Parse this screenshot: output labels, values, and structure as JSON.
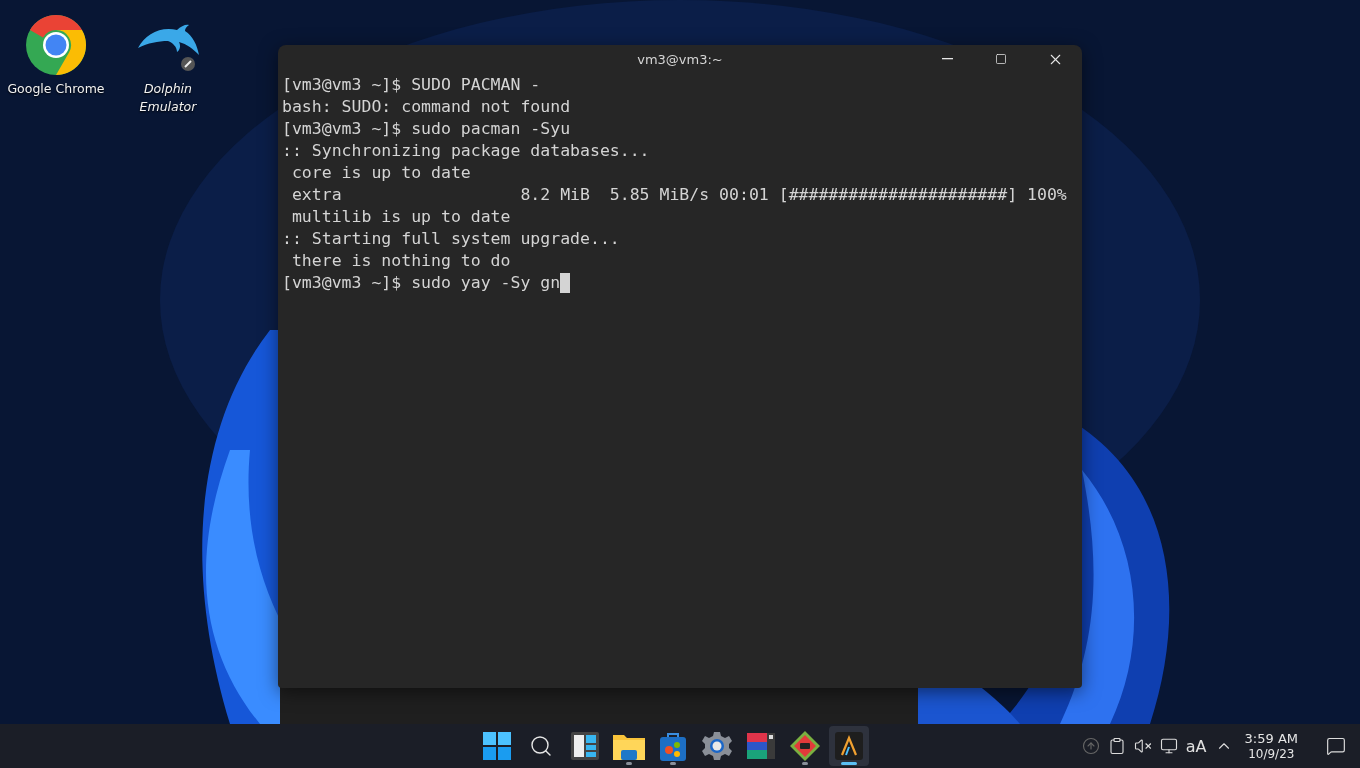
{
  "desktop_icons": [
    {
      "label": "Google Chrome",
      "kind": "chrome",
      "italic": false
    },
    {
      "label": "Dolphin Emulator",
      "kind": "dolphin",
      "italic": true
    }
  ],
  "terminal": {
    "title": "vm3@vm3:~",
    "lines": [
      "[vm3@vm3 ~]$ SUDO PACMAN -",
      "bash: SUDO: command not found",
      "[vm3@vm3 ~]$ sudo pacman -Syu",
      ":: Synchronizing package databases...",
      " core is up to date",
      " extra                  8.2 MiB  5.85 MiB/s 00:01 [######################] 100%",
      " multilib is up to date",
      ":: Starting full system upgrade...",
      " there is nothing to do",
      "[vm3@vm3 ~]$ sudo yay -Sy gn"
    ],
    "cursor": true
  },
  "taskbar": {
    "apps": [
      {
        "kind": "start",
        "running": false,
        "selected": false
      },
      {
        "kind": "search",
        "running": false,
        "selected": false
      },
      {
        "kind": "widgets",
        "running": false,
        "selected": false
      },
      {
        "kind": "folder",
        "running": true,
        "selected": false
      },
      {
        "kind": "store",
        "running": true,
        "selected": false
      },
      {
        "kind": "settings",
        "running": false,
        "selected": false
      },
      {
        "kind": "tiles",
        "running": false,
        "selected": false
      },
      {
        "kind": "game",
        "running": true,
        "selected": false
      },
      {
        "kind": "terminal",
        "running": true,
        "selected": true
      }
    ],
    "tray": {
      "font_label": "aA",
      "time": "3:59 AM",
      "date": "10/9/23"
    }
  }
}
